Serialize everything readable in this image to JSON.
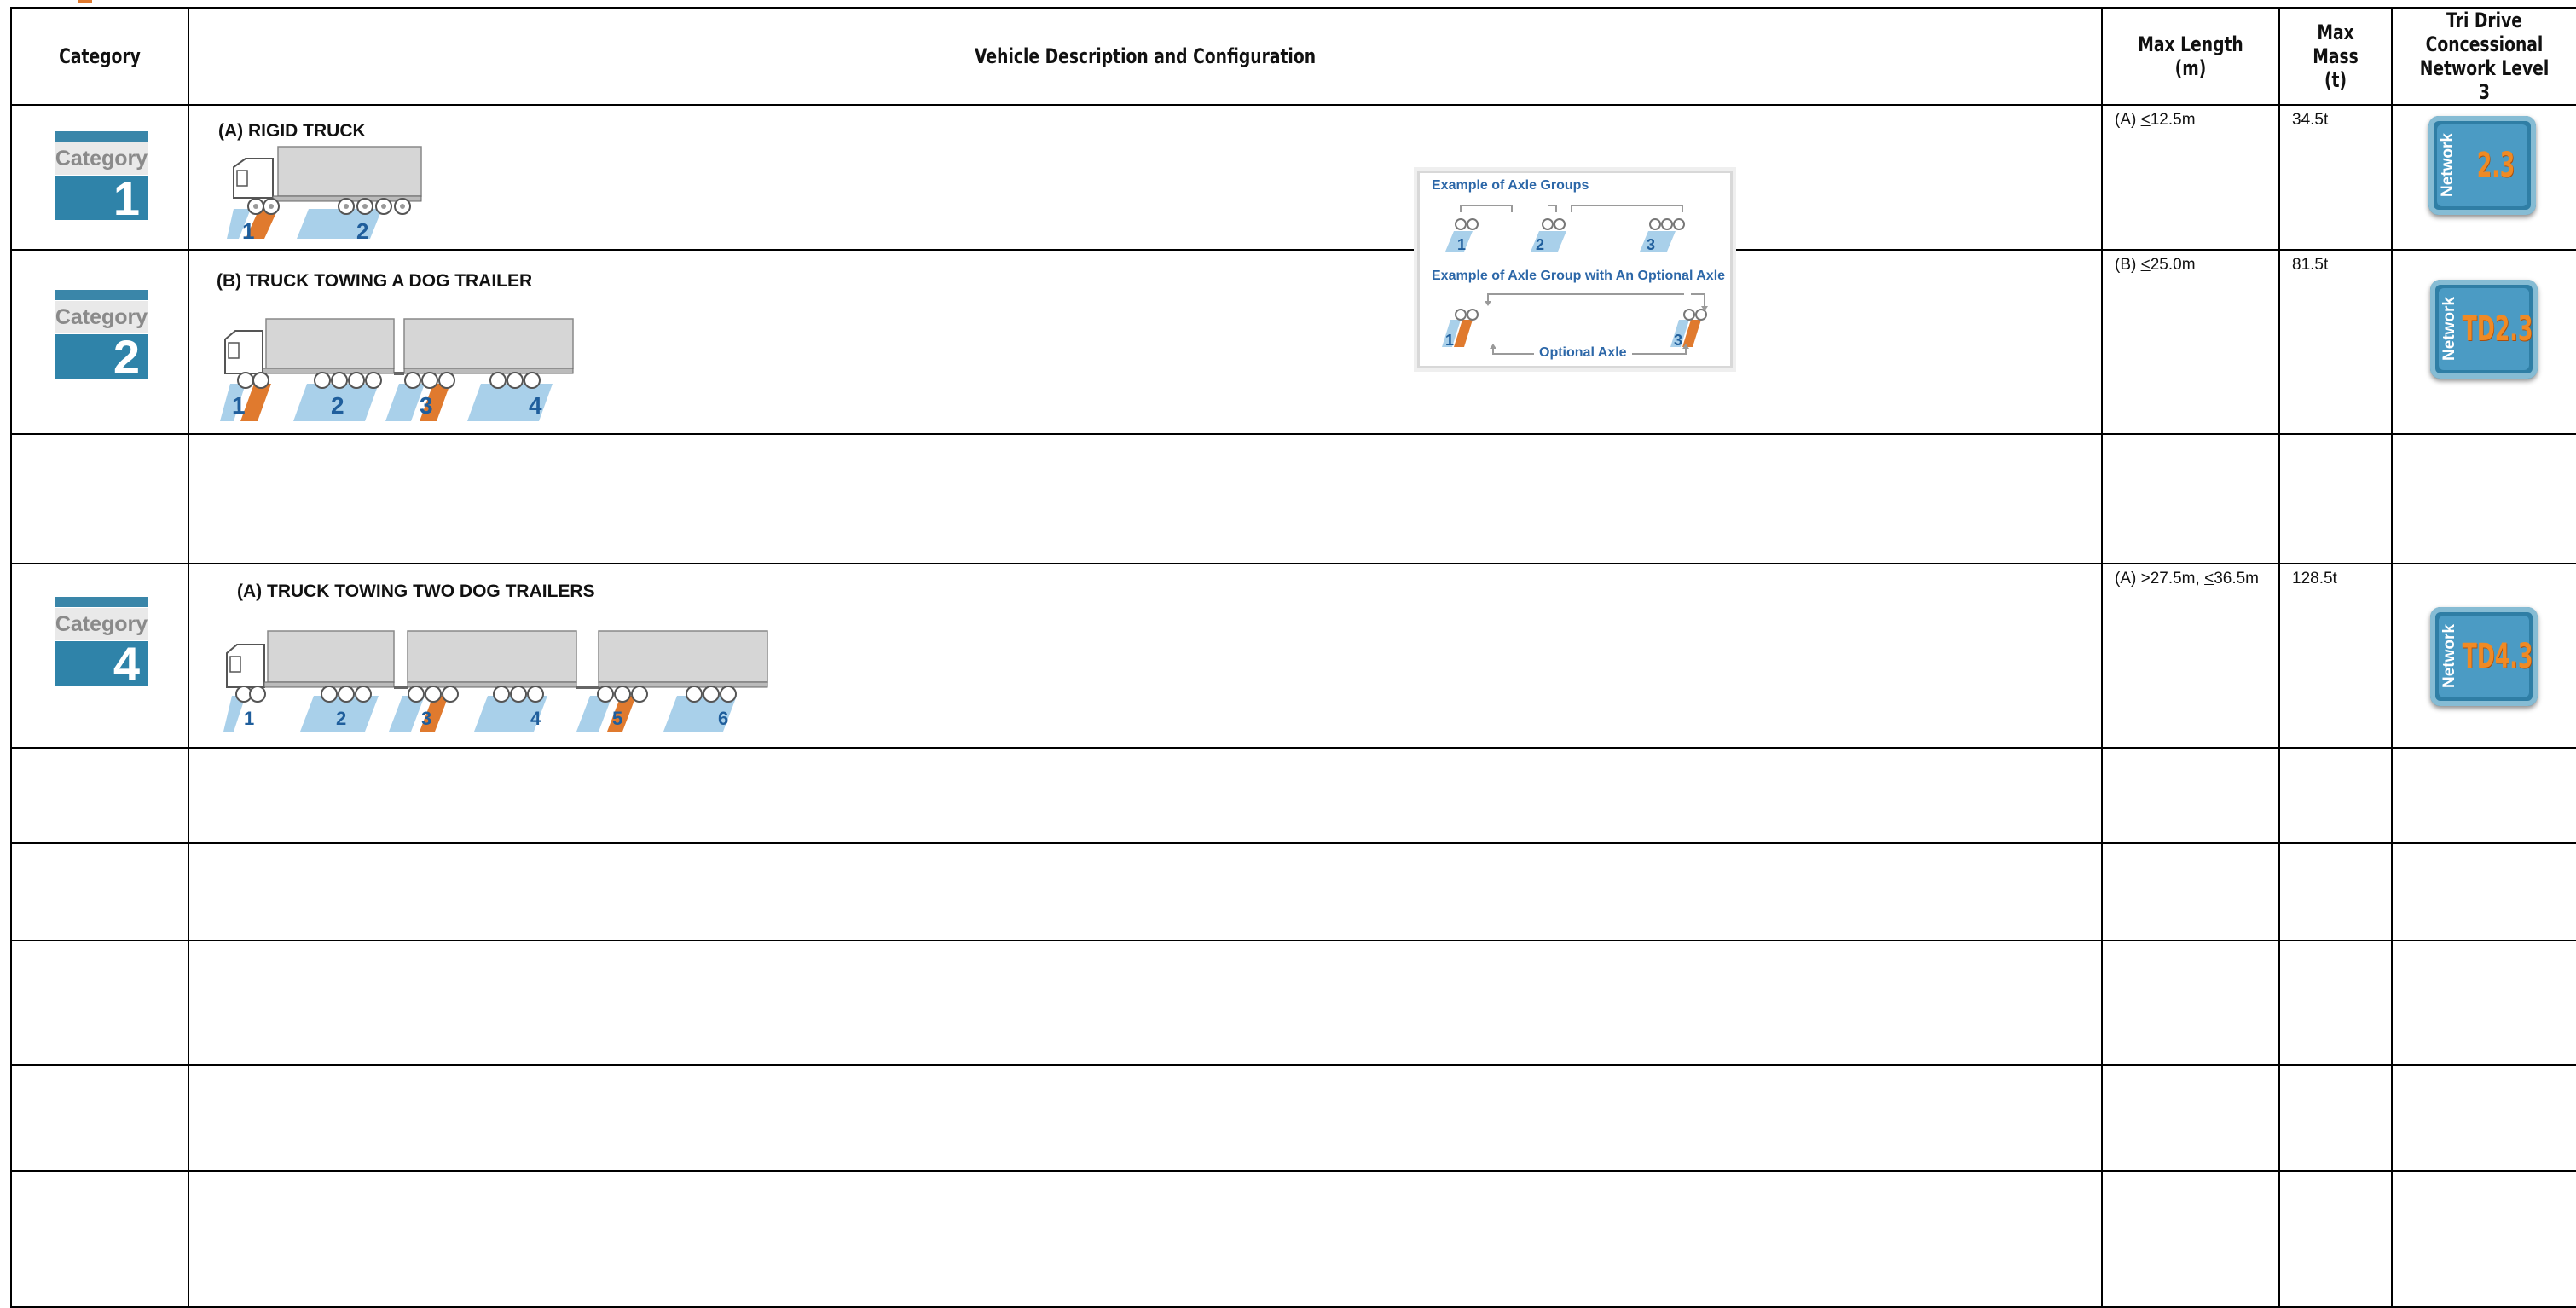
{
  "headers": {
    "category": "Category",
    "description": "Vehicle Description and Configuration",
    "max_length": "Max Length (m)",
    "max_mass_1": "Max Mass",
    "max_mass_2": "(t)",
    "tri_1": "Tri Drive",
    "tri_2": "Concessional",
    "tri_3": "Network Level 3"
  },
  "rows": [
    {
      "badge_word": "Category",
      "badge_num": "1",
      "title": "(A) RIGID TRUCK",
      "length_prefix": "(A) ",
      "length_sym": "<",
      "length_val": "12.5m",
      "mass": "34.5t",
      "net_side": "Network",
      "net_code": "2.3",
      "axles": [
        "1",
        "2"
      ]
    },
    {
      "badge_word": "Category",
      "badge_num": "2",
      "title": "(B) TRUCK TOWING A DOG TRAILER",
      "length_prefix": "(B) ",
      "length_sym": "<",
      "length_val": "25.0m",
      "mass": "81.5t",
      "net_side": "Network",
      "net_code": "TD2.3",
      "axles": [
        "1",
        "2",
        "3",
        "4"
      ]
    },
    {
      "badge_word": "Category",
      "badge_num": "4",
      "title": "(A) TRUCK TOWING TWO DOG TRAILERS",
      "length_prefix": "(A) >27.5m, ",
      "length_sym": "<",
      "length_val": "36.5m",
      "mass": "128.5t",
      "net_side": "Network",
      "net_code": "TD4.3",
      "axles": [
        "1",
        "2",
        "3",
        "4",
        "5",
        "6"
      ]
    }
  ],
  "axle_example": {
    "title1": "Example of Axle Groups",
    "title2": "Example of Axle Group with An Optional Axle",
    "optional_label": "Optional Axle",
    "nums1": [
      "1",
      "2",
      "3"
    ],
    "nums2": [
      "1",
      "3"
    ]
  },
  "colors": {
    "badge_blue": "#2f83a9",
    "orange": "#e07a2e",
    "axle_blue": "#a9d0ea",
    "axle_num": "#1f5e9c"
  }
}
